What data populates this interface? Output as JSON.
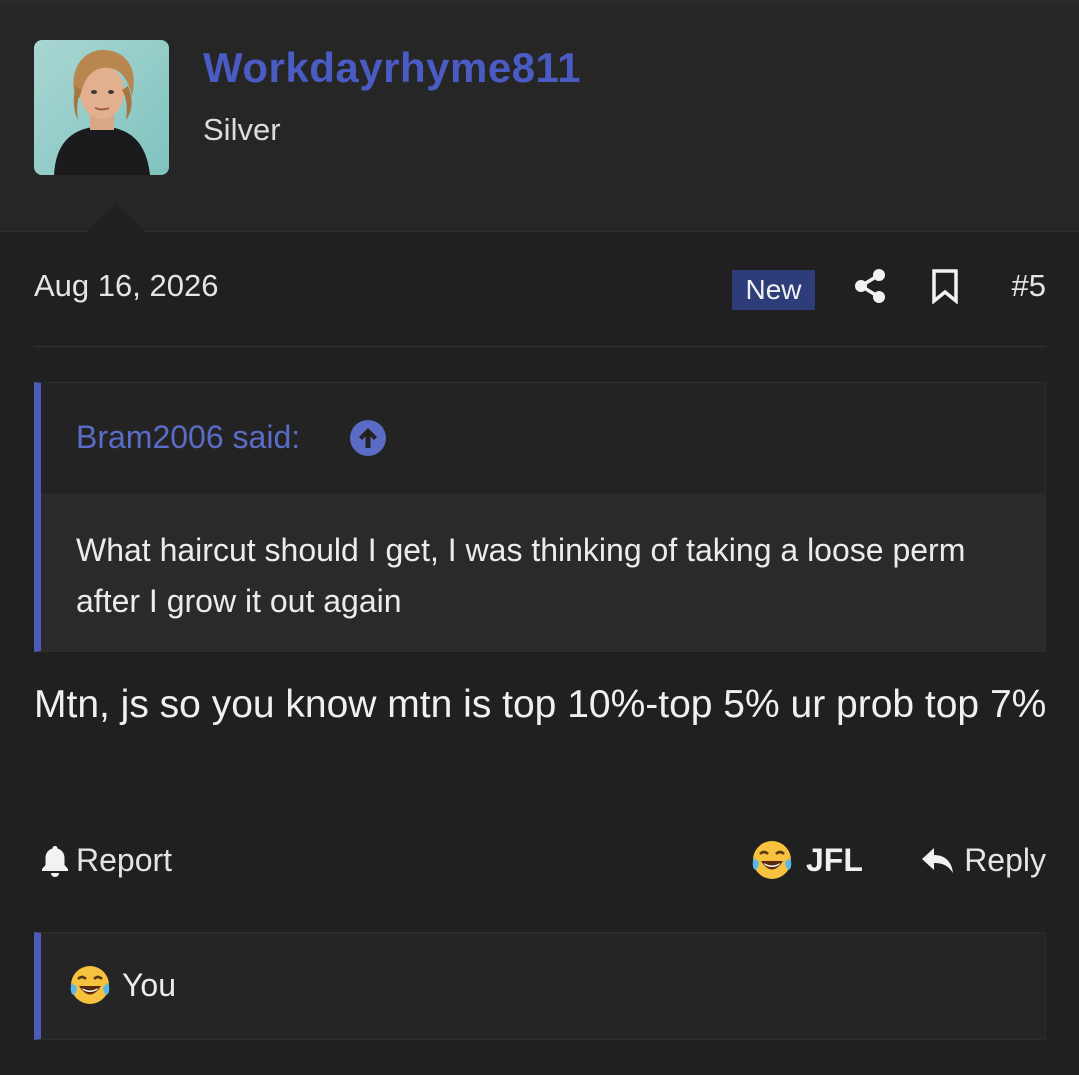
{
  "post": {
    "author": "Workdayrhyme811",
    "user_title": "Silver",
    "date": "Aug 16, 2026",
    "new_badge": "New",
    "post_number": "#5",
    "quote": {
      "author_said": "Bram2006 said:",
      "text": "What haircut should I get, I was thinking of taking a loose perm after I grow it out again"
    },
    "message": "Mtn, js so you know mtn is top 10%-top 5% ur prob top 7%",
    "actions": {
      "report": "Report",
      "reaction_label": "JFL",
      "reply": "Reply"
    },
    "reactions_summary": "You"
  },
  "icons": {
    "avatar": "user-avatar-photo",
    "share": "share-icon",
    "bookmark": "bookmark-icon",
    "quote_jump": "arrow-up-circle-icon",
    "report": "bell-icon",
    "reaction": "laughing-tears-emoji",
    "reply": "reply-arrow-icon"
  },
  "colors": {
    "username": "#4a5bc4",
    "accent_border": "#4f5bb8",
    "new_badge_bg": "#2d3d7a",
    "background": "#202020"
  }
}
